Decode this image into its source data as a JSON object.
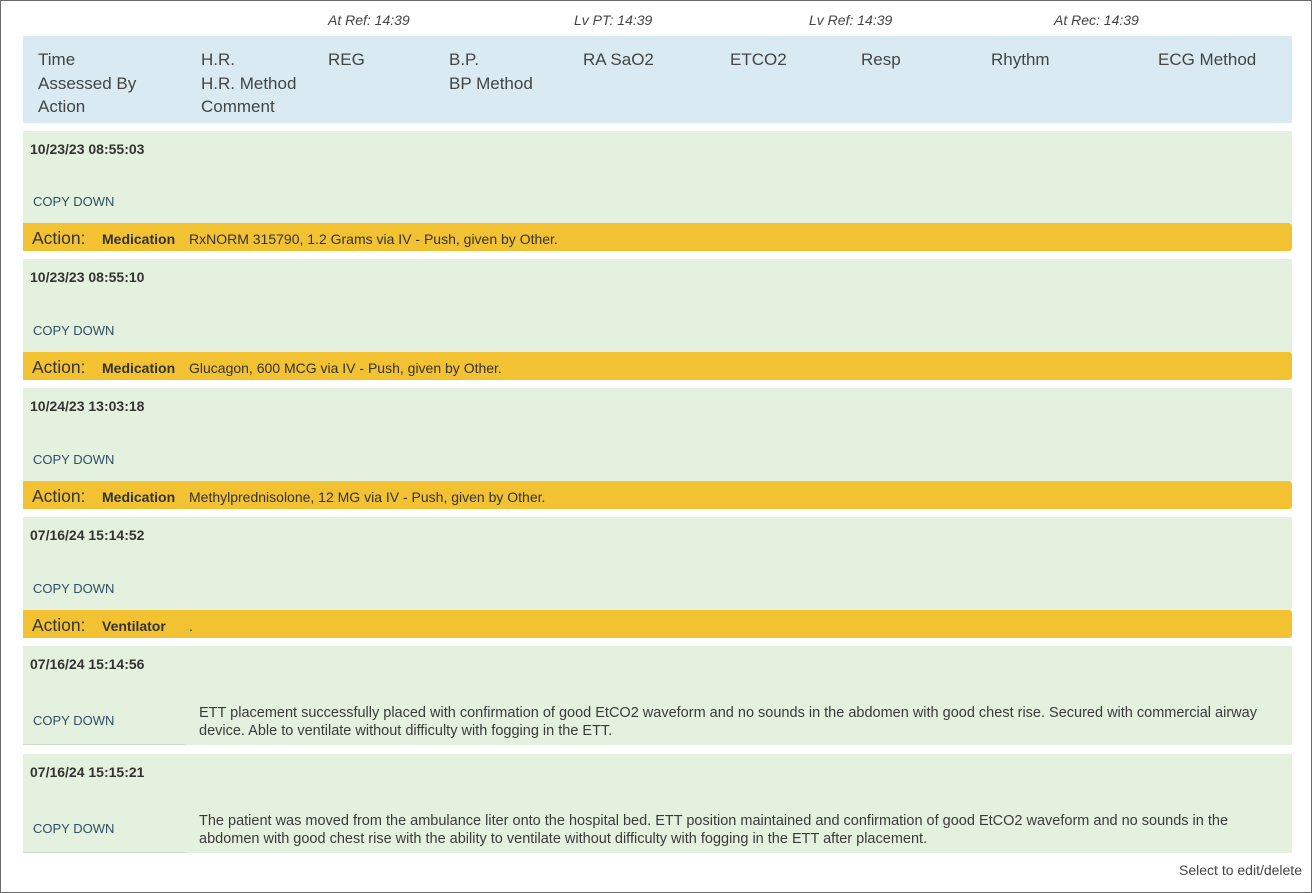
{
  "top_labels": [
    "At Ref: 14:39",
    "Lv PT: 14:39",
    "Lv Ref: 14:39",
    "At Rec: 14:39"
  ],
  "columns": {
    "c1": [
      "Time",
      "Assessed By",
      "Action"
    ],
    "c2": [
      "H.R.",
      "H.R. Method",
      "Comment"
    ],
    "c3": [
      "REG"
    ],
    "c4": [
      "B.P.",
      "BP Method"
    ],
    "c5": [
      "RA SaO2"
    ],
    "c6": [
      "ETCO2"
    ],
    "c7": [
      "Resp"
    ],
    "c8": [
      "Rhythm"
    ],
    "c9": [
      "ECG Method"
    ]
  },
  "copy_down_label": "COPY DOWN",
  "action_label": "Action:",
  "entries": [
    {
      "timestamp": "10/23/23 08:55:03",
      "action_type": "Medication",
      "action_text": "RxNORM 315790, 1.2 Grams via IV - Push, given by Other."
    },
    {
      "timestamp": "10/23/23 08:55:10",
      "action_type": "Medication",
      "action_text": "Glucagon, 600 MCG via IV - Push, given by Other."
    },
    {
      "timestamp": "10/24/23 13:03:18",
      "action_type": "Medication",
      "action_text": "Methylprednisolone, 12 MG via IV - Push, given by Other."
    },
    {
      "timestamp": "07/16/24 15:14:52",
      "action_type": "Ventilator",
      "action_text": "."
    },
    {
      "timestamp": "07/16/24 15:14:56",
      "comment": "ETT placement successfully placed with confirmation of good EtCO2 waveform and no sounds in the abdomen with good chest rise. Secured with commercial airway device. Able to ventilate without difficulty with fogging in the ETT."
    },
    {
      "timestamp": "07/16/24 15:15:21",
      "comment": "The patient was moved from the ambulance liter onto the hospital bed. ETT position maintained and confirmation of good EtCO2 waveform and no sounds in the abdomen with good chest rise with the ability to ventilate without difficulty with fogging in the ETT after placement."
    }
  ],
  "footer": {
    "select_label": "Select to edit/delete"
  },
  "colors": {
    "header_bg": "#d9eaf3",
    "entry_bg": "#e3f1de",
    "action_bg": "#f3c233",
    "link": "#2d4f66"
  }
}
